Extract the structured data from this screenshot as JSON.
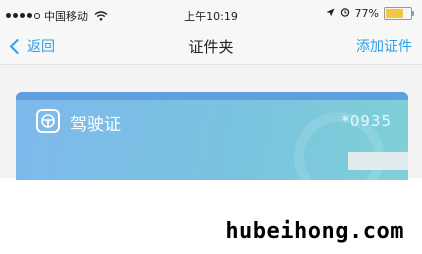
{
  "status_bar": {
    "carrier": "中国移动",
    "time": "上午10:19",
    "battery": "77%",
    "battery_level": 0.77
  },
  "nav": {
    "back_label": "返回",
    "title": "证件夹",
    "add_label": "添加证件"
  },
  "card": {
    "label": "驾驶证",
    "number": "*0935"
  },
  "watermark": "hubeihong.com",
  "colors": {
    "accent": "#2e9fe6",
    "card_start": "#7fb8ec",
    "card_end": "#80d0d8"
  }
}
